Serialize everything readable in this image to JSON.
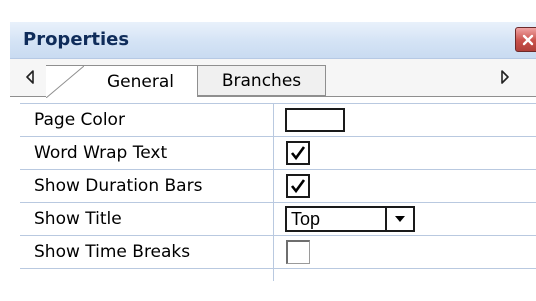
{
  "panel": {
    "title": "Properties"
  },
  "tabs": [
    {
      "label": "General",
      "active": true
    },
    {
      "label": "Branches",
      "active": false
    }
  ],
  "properties": [
    {
      "name": "Page Color",
      "type": "color",
      "value": "#ffffff"
    },
    {
      "name": "Word Wrap Text",
      "type": "checkbox",
      "checked": true
    },
    {
      "name": "Show Duration Bars",
      "type": "checkbox",
      "checked": true
    },
    {
      "name": "Show Title",
      "type": "select",
      "value": "Top"
    },
    {
      "name": "Show Time Breaks",
      "type": "checkbox",
      "checked": false
    }
  ],
  "icons": {
    "close": "close-icon",
    "tab_left": "chevron-left-icon",
    "tab_right": "chevron-right-icon",
    "dropdown": "chevron-down-icon",
    "check": "check-icon"
  },
  "colors": {
    "titlebar": "#d4e3f5",
    "close_button": "#c9514b",
    "grid_line": "#b9c9e0"
  }
}
